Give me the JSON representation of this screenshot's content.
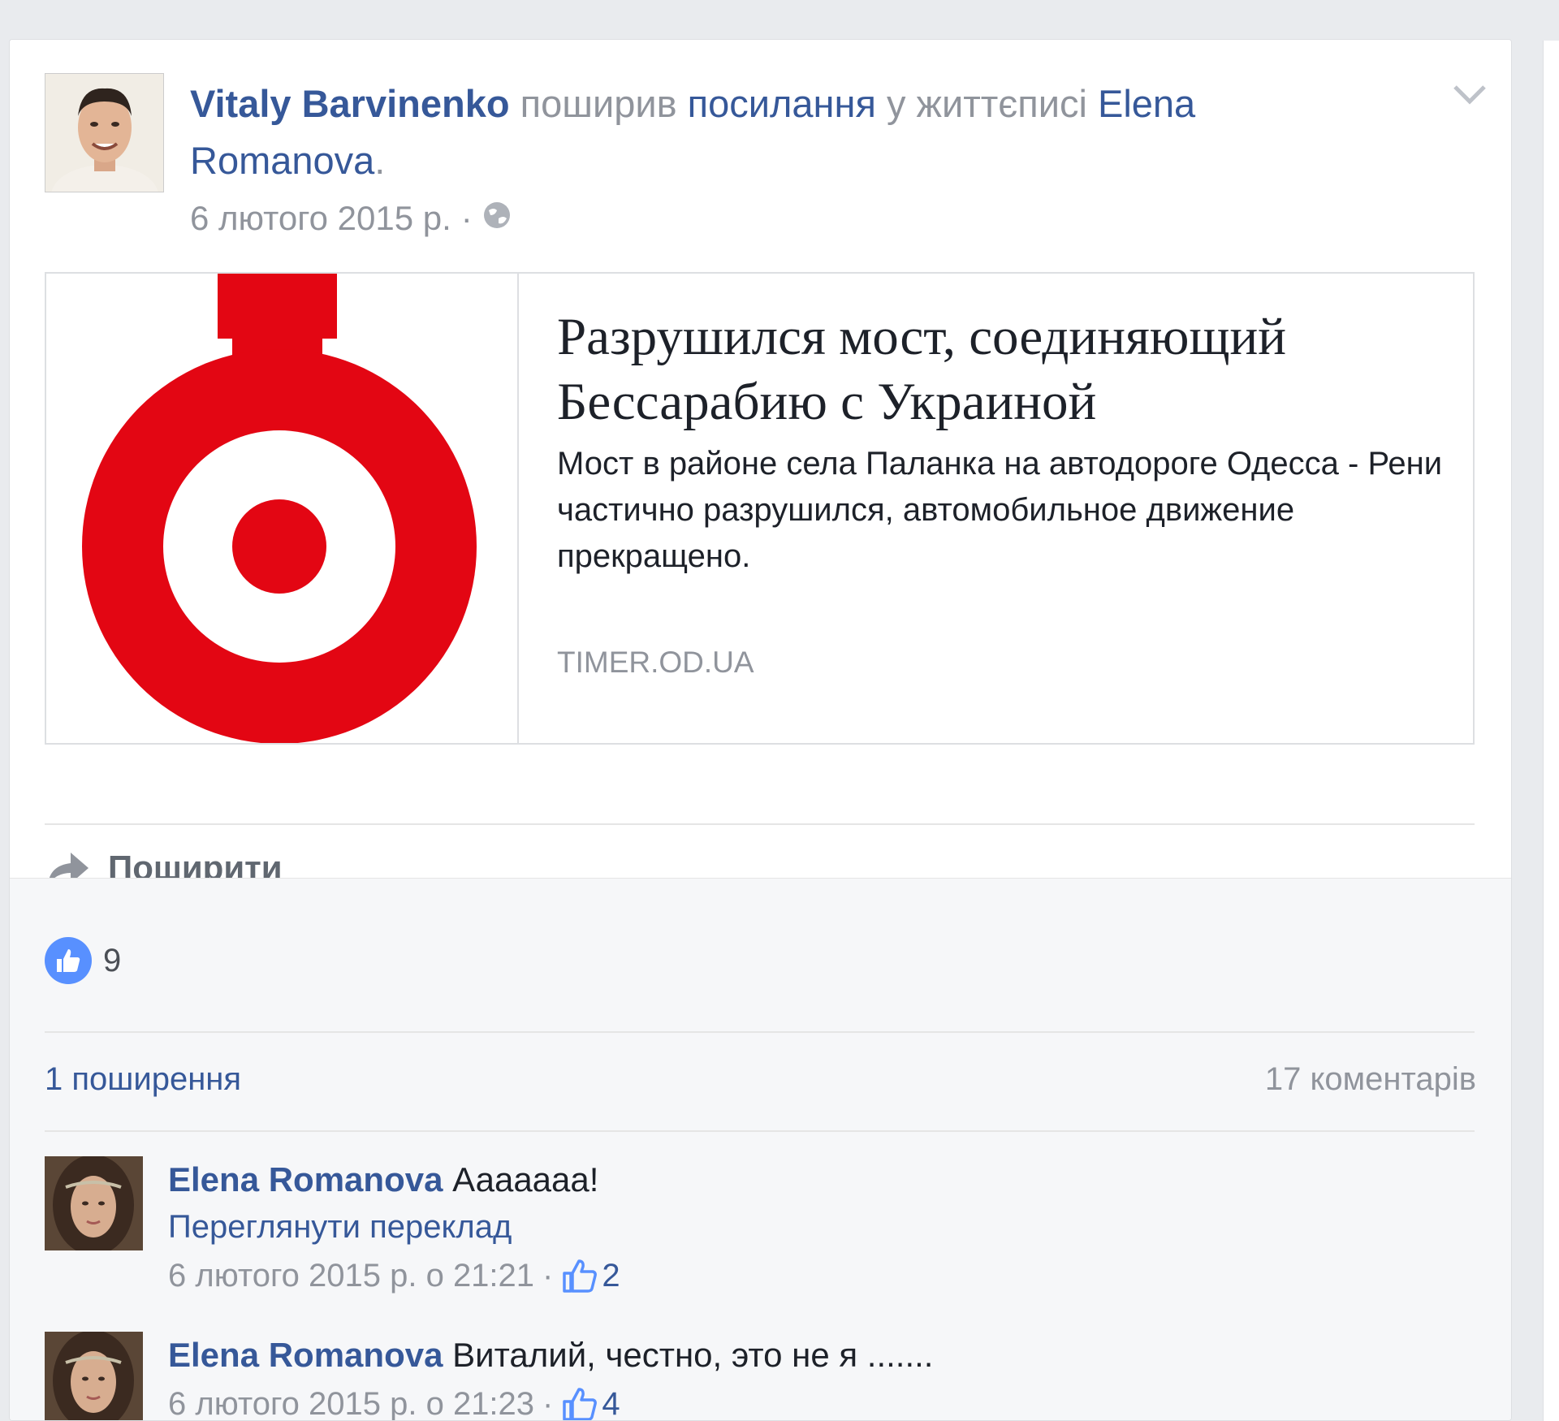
{
  "post": {
    "author": "Vitaly Barvinenko",
    "action_1": "поширив",
    "action_link": "посилання",
    "action_2": "у життєписі",
    "target_first": "Elena",
    "target_last": "Romanova",
    "period": ".",
    "timestamp": "6 лютого 2015 р.",
    "dot_sep": "·",
    "privacy_icon": "globe-icon"
  },
  "link_preview": {
    "title": "Разрушился мост, соединяющий Бессарабию с Украиной",
    "description": "Мост в районе села Паланка на автодороге Одесса - Рени частично разрушился, автомобильное движение прекращено.",
    "domain": "TIMER.OD.UA",
    "logo_color": "#e30613"
  },
  "actions": {
    "share_label": "Поширити"
  },
  "stats": {
    "likes": "9",
    "shares": "1 поширення",
    "comments": "17 коментарів"
  },
  "comments": [
    {
      "author": "Elena Romanova",
      "text": "Ааааааа!",
      "translate": "Переглянути переклад",
      "time": "6 лютого 2015 р. о 21:21",
      "sep": "·",
      "likes": "2"
    },
    {
      "author": "Elena Romanova",
      "text": "Виталий, честно, это не я .......",
      "time": "6 лютого 2015 р. о 21:23",
      "sep": "·",
      "likes": "4"
    }
  ],
  "colors": {
    "link_blue": "#365899",
    "meta_grey": "#90949c",
    "like_blue": "#5890ff",
    "background": "#e9ebee"
  }
}
